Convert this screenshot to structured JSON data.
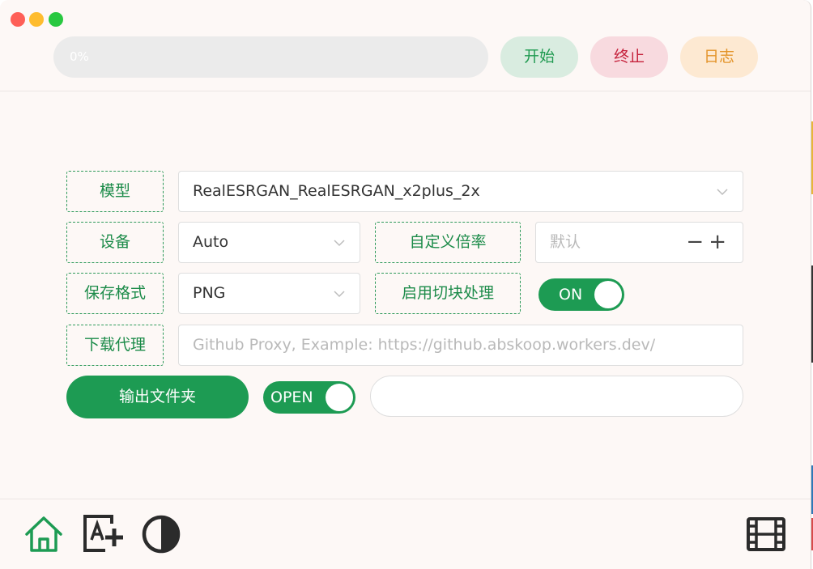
{
  "window": {
    "controls": [
      "close",
      "minimize",
      "maximize"
    ]
  },
  "toolbar": {
    "progress_text": "0%",
    "start_label": "开始",
    "stop_label": "终止",
    "log_label": "日志"
  },
  "form": {
    "model": {
      "label": "模型",
      "value": "RealESRGAN_RealESRGAN_x2plus_2x"
    },
    "device": {
      "label": "设备",
      "value": "Auto"
    },
    "scale": {
      "label": "自定义倍率",
      "placeholder": "默认",
      "minus": "−",
      "plus": "+"
    },
    "format": {
      "label": "保存格式",
      "value": "PNG"
    },
    "tile": {
      "label": "启用切块处理",
      "toggle": "ON"
    },
    "proxy": {
      "label": "下载代理",
      "placeholder": "Github Proxy, Example: https://github.abskoop.workers.dev/"
    },
    "output": {
      "button": "输出文件夹",
      "toggle": "OPEN",
      "path": ""
    }
  },
  "nav": {
    "items": [
      {
        "icon": "home-icon",
        "active": true
      },
      {
        "icon": "text-image-add-icon",
        "active": false
      },
      {
        "icon": "contrast-icon",
        "active": false
      },
      {
        "icon": "film-icon",
        "active": false
      }
    ]
  },
  "colors": {
    "accent": "#1d9b53",
    "start_bg": "#d9ece0",
    "stop_bg": "#f8dadf",
    "stop_text": "#c5213b",
    "log_bg": "#fde9d2",
    "log_text": "#e3942a",
    "background": "#fdf8f6"
  }
}
